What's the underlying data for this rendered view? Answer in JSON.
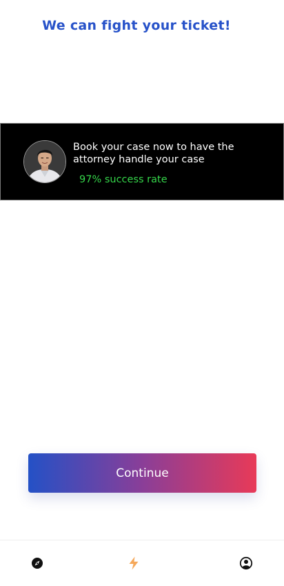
{
  "header": {
    "title": "We can fight your ticket!"
  },
  "banner": {
    "message": "Book your case now to have the attorney handle your case",
    "success_rate": "97% success rate",
    "avatar": "attorney-portrait"
  },
  "actions": {
    "continue_label": "Continue"
  },
  "bottom_nav": {
    "items": [
      {
        "icon": "compass-icon"
      },
      {
        "icon": "lightning-icon",
        "active": true
      },
      {
        "icon": "user-circle-icon"
      }
    ]
  },
  "colors": {
    "title": "#2752c9",
    "success": "#35d64a",
    "active_nav": "#f5a85a",
    "gradient_start": "#2451c6",
    "gradient_end": "#e83a58"
  }
}
